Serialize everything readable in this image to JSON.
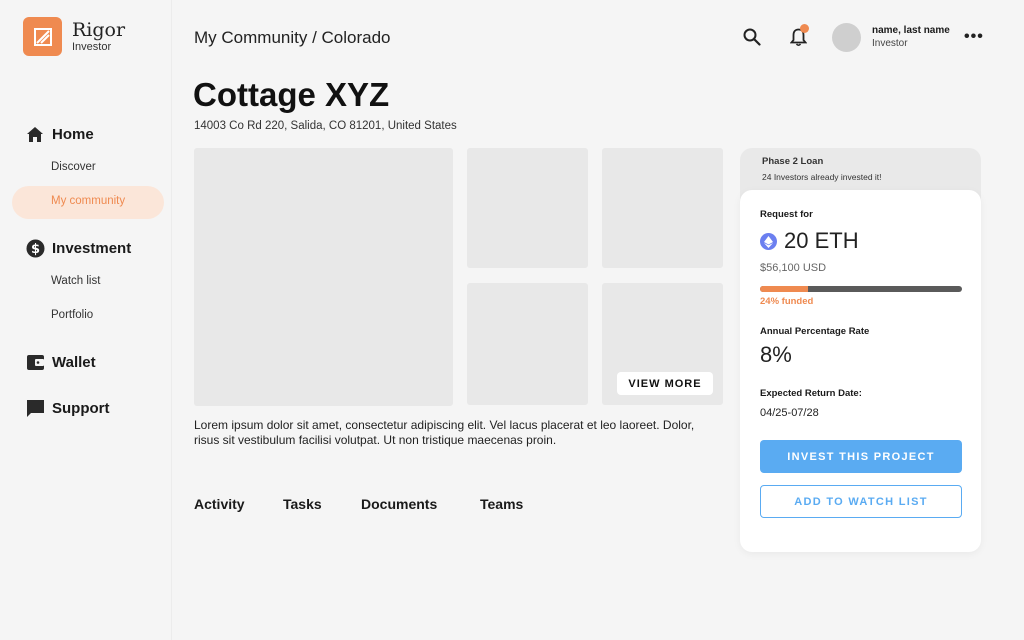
{
  "brand": {
    "name": "Rigor",
    "subtitle": "Investor"
  },
  "sidebar": {
    "sections": [
      {
        "label": "Home",
        "icon": "home-icon"
      },
      {
        "label": "Investment",
        "icon": "dollar-icon"
      },
      {
        "label": "Wallet",
        "icon": "wallet-icon"
      },
      {
        "label": "Support",
        "icon": "chat-icon"
      }
    ],
    "items": [
      {
        "label": "Discover"
      },
      {
        "label": "My community",
        "active": true
      },
      {
        "label": "Watch list"
      },
      {
        "label": "Portfolio"
      }
    ]
  },
  "header": {
    "breadcrumb": "My Community / Colorado",
    "user_name": "name, last name",
    "user_role": "Investor"
  },
  "property": {
    "title": "Cottage XYZ",
    "address": "14003 Co Rd 220, Salida, CO 81201, United States",
    "view_more": "VIEW MORE",
    "description": "Lorem ipsum dolor sit amet, consectetur adipiscing elit. Vel lacus placerat et leo laoreet. Dolor, risus sit vestibulum facilisi volutpat. Ut non tristique maecenas proin."
  },
  "tabs": [
    "Activity",
    "Tasks",
    "Documents",
    "Teams"
  ],
  "card": {
    "phase": "Phase 2  Loan",
    "investors": "24 Investors already invested it!",
    "request_label": "Request for",
    "amount": "20 ETH",
    "usd": "$56,100 USD",
    "funded_fraction": 0.24,
    "funded_text": "24% funded",
    "apr_label": "Annual Percentage Rate",
    "apr": "8%",
    "return_label": "Expected Return Date:",
    "return_date": "04/25-07/28",
    "invest_button": "INVEST THIS PROJECT",
    "watch_button": "ADD TO WATCH LIST"
  },
  "colors": {
    "accent": "#ef8a50",
    "primary_button": "#5aabf2",
    "eth": "#6b7ff0"
  }
}
